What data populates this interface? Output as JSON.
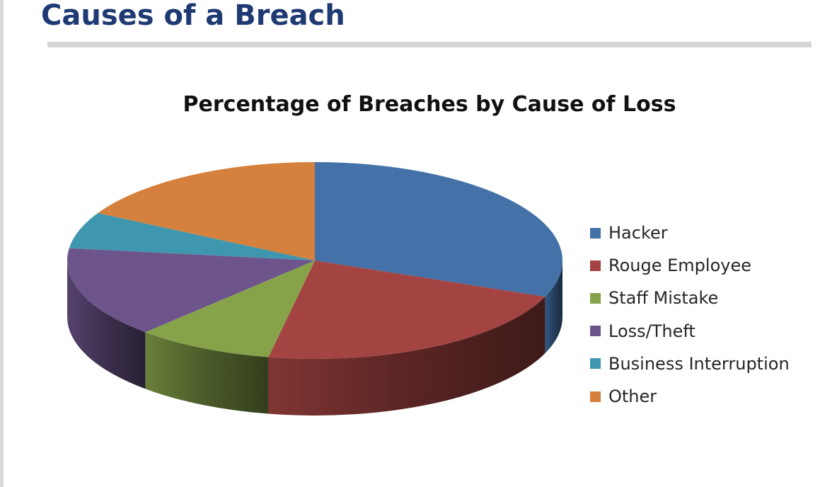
{
  "slide": {
    "title": "Causes of a Breach"
  },
  "chart_data": {
    "type": "pie",
    "title": "Percentage of Breaches by Cause of Loss",
    "unit": "%",
    "style": "3d",
    "legend_position": "right",
    "categories": [
      "Hacker",
      "Rouge Employee",
      "Staff Mistake",
      "Loss/Theft",
      "Business Interruption",
      "Other"
    ],
    "values": [
      31,
      22,
      9,
      15,
      6,
      17
    ],
    "colors": [
      "#4472a8",
      "#a44442",
      "#86a34a",
      "#6d558c",
      "#3e97ae",
      "#d5803c"
    ]
  }
}
